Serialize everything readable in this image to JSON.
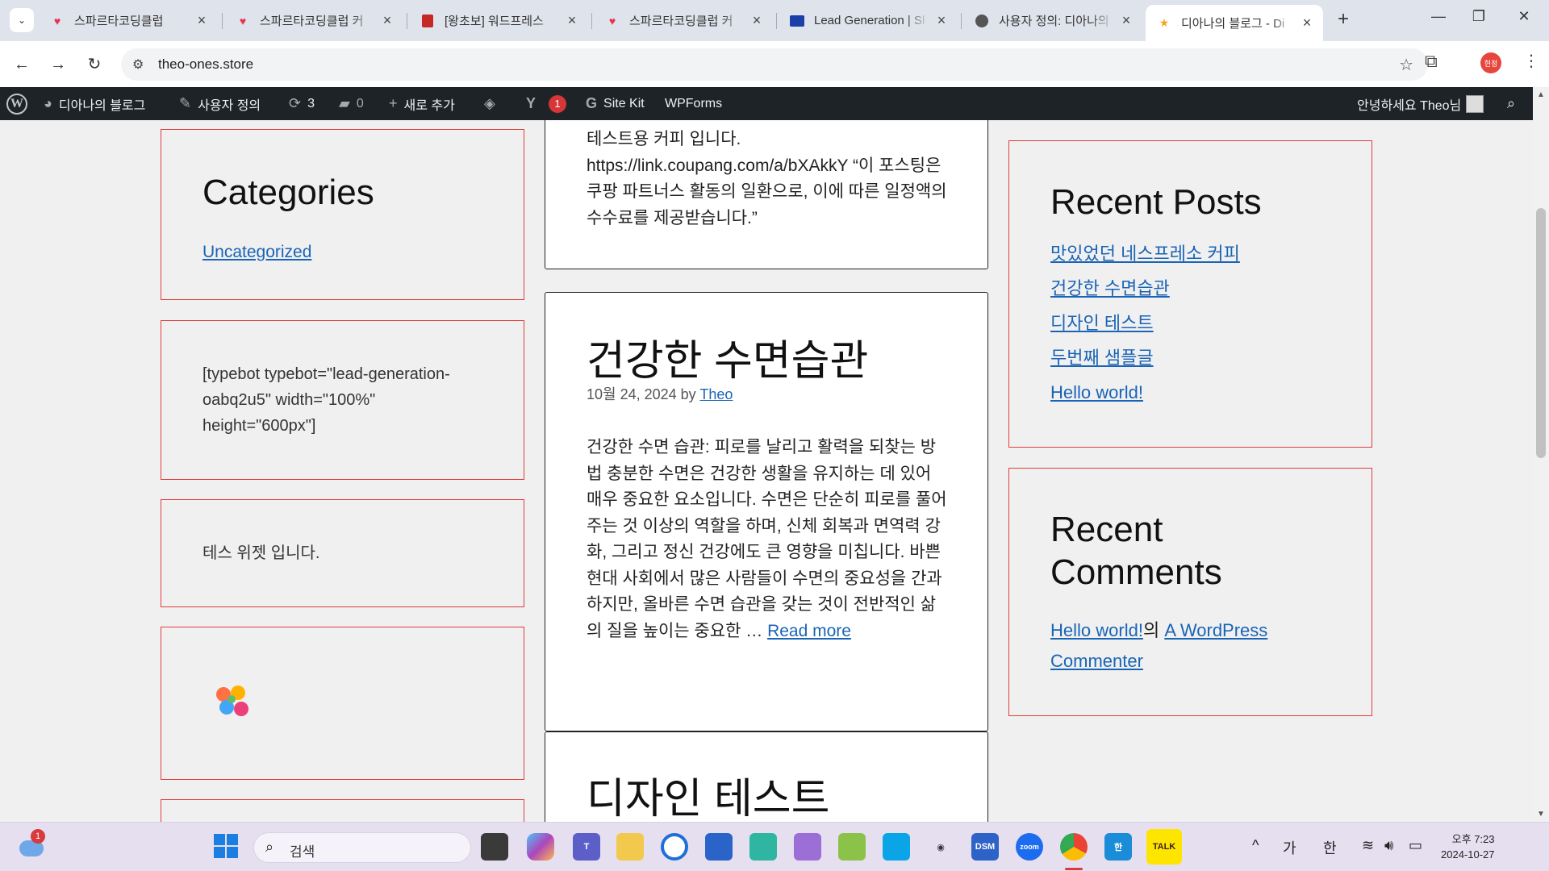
{
  "browser": {
    "tabs": [
      {
        "title": "스파르타코딩클럽",
        "icon": "heart-logo",
        "color": "#e8344e"
      },
      {
        "title": "스파르타코딩클럽 커",
        "icon": "heart-logo",
        "color": "#e8344e"
      },
      {
        "title": "[왕초보] 워드프레스",
        "icon": "book-icon",
        "color": "#c62828"
      },
      {
        "title": "스파르타코딩클럽 커",
        "icon": "heart-logo",
        "color": "#e8344e"
      },
      {
        "title": "Lead Generation | Sl",
        "icon": "card-icon",
        "color": "#1a3fa8"
      },
      {
        "title": "사용자 정의: 디아나의",
        "icon": "wordpress-icon",
        "color": "#555555"
      },
      {
        "title": "디아나의 블로그 - Di",
        "icon": "star-icon",
        "color": "#f5a623"
      }
    ],
    "url": "theo-ones.store",
    "profile_label": "현정"
  },
  "admin_bar": {
    "site_name": "디아나의 블로그",
    "customize": "사용자 정의",
    "updates_count": "3",
    "comments_count": "0",
    "new_label": "새로 추가",
    "yoast_badge": "1",
    "sitekit": "Site Kit",
    "wpforms": "WPForms",
    "greeting": "안녕하세요 Theo님"
  },
  "left_sidebar": {
    "categories_title": "Categories",
    "categories_link": "Uncategorized",
    "shortcode_text": "[typebot typebot=\"lead-generation-oabq2u5\" width=\"100%\" height=\"600px\"]",
    "test_widget_text": "테스 위젯 입니다."
  },
  "posts": [
    {
      "excerpt_tail": "테스트용 커피 입니다. https://link.coupang.com/a/bXAkkY “이 포스팅은 쿠팡 파트너스 활동의 일환으로, 이에 따른 일정액의 수수료를 제공받습니다.”"
    },
    {
      "title": "건강한 수면습관",
      "date": "10월 24, 2024",
      "by": "by",
      "author": "Theo",
      "excerpt": "건강한 수면 습관: 피로를 날리고 활력을 되찾는 방법   충분한 수면은 건강한 생활을 유지하는 데 있어 매우 중요한 요소입니다. 수면은 단순히 피로를 풀어주는 것 이상의 역할을 하며, 신체 회복과 면역력 강화, 그리고 정신 건강에도 큰 영향을 미칩니다. 바쁜 현대 사회에서 많은 사람들이 수면의 중요성을 간과하지만, 올바른 수면 습관을 갖는 것이 전반적인 삶의 질을 높이는 중요한 …",
      "read_more": "Read more"
    },
    {
      "title": "디자인 테스트"
    }
  ],
  "right_sidebar": {
    "recent_posts_title": "Recent Posts",
    "recent_posts": [
      "맛있었던 네스프레소 커피",
      "건강한 수면습관",
      "디자인 테스트",
      "두번째 샘플글",
      "Hello world!"
    ],
    "recent_comments_title": "Recent Comments",
    "comment_link": "Hello world!",
    "comment_particle": "의",
    "comment_author": "A WordPress Commenter"
  },
  "taskbar": {
    "widgets_badge": "1",
    "search_label": "검색",
    "ime_ga": "가",
    "ime_han": "한",
    "time": "오후 7:23",
    "date": "2024-10-27"
  }
}
